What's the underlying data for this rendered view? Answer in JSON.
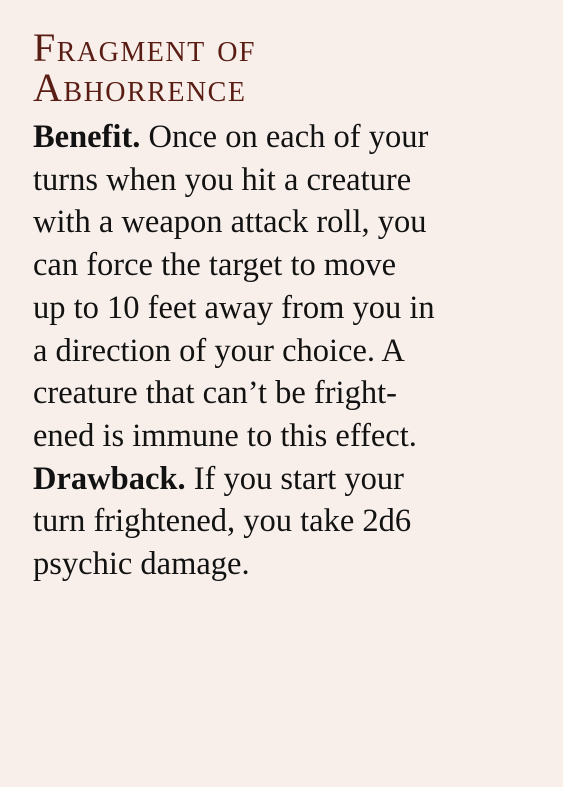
{
  "title": {
    "line1": "Fragment of",
    "line2": "Abhorrence"
  },
  "benefit": {
    "label": "Benefit.",
    "lines": [
      "Once on each of your",
      "turns when you hit a creature",
      "with a weapon attack roll, you",
      "can force the target to move",
      "up to 10 feet away from you in",
      "a direction of your choice. A",
      "creature that can’t be fright-",
      "ened is immune to this effect."
    ]
  },
  "drawback": {
    "label": "Drawback.",
    "lines": [
      "If you start your",
      "turn frightened, you take 2d6",
      "psychic damage."
    ]
  },
  "colors": {
    "background": "#f8efea",
    "heading": "#5a1d14",
    "body_text": "#121212"
  }
}
